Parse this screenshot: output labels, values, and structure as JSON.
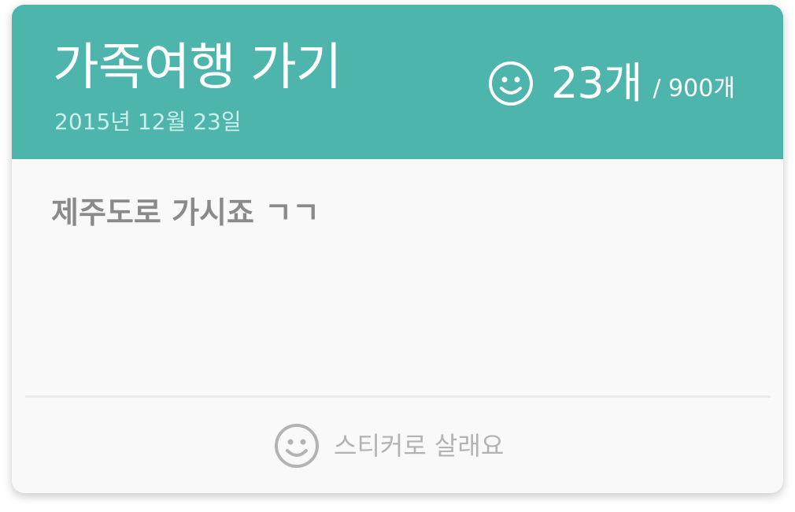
{
  "card": {
    "title": "가족여행 가기",
    "date": "2015년 12월 23일",
    "sticker_count": "23개",
    "sticker_total": "/ 900개",
    "message": "제주도로 가시죠 ㄱㄱ",
    "buy_label": "스티커로 살래요"
  },
  "icons": {
    "counter": "smiley-icon",
    "buy": "smiley-icon"
  },
  "colors": {
    "header": "#4db5ac",
    "card": "#f9f9f9",
    "message": "#8a8a8a",
    "buy": "#b3b3b3"
  }
}
